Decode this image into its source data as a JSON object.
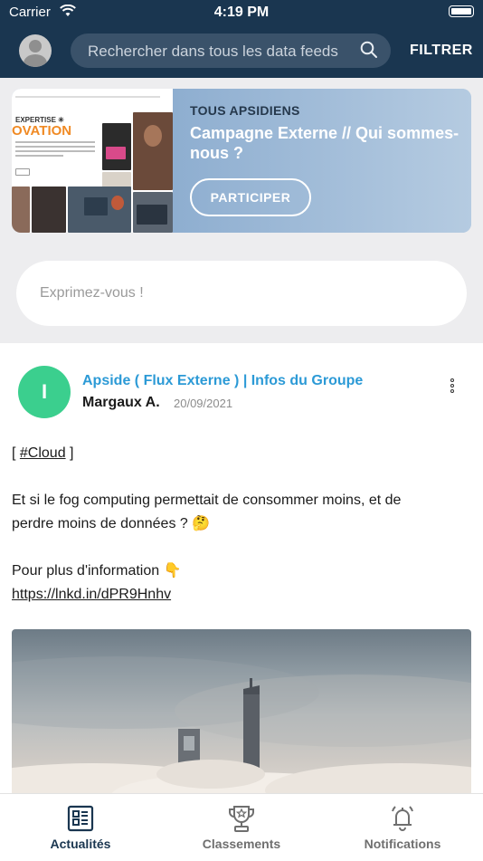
{
  "status_bar": {
    "carrier": "Carrier",
    "time": "4:19 PM"
  },
  "header": {
    "search_placeholder": "Rechercher dans tous les data feeds",
    "filter_label": "FILTRER"
  },
  "banner": {
    "tag": "TOUS APSIDIENS",
    "title": "Campagne Externe // Qui sommes-nous ?",
    "button_label": "PARTICIPER",
    "thumbnail": {
      "overline": "EXPERTISE ✳",
      "headline": "OVATION"
    }
  },
  "composer": {
    "placeholder": "Exprimez-vous !"
  },
  "post": {
    "avatar_initial": "I",
    "group": "Apside ( Flux Externe ) | Infos du Groupe",
    "author": "Margaux A.",
    "date": "20/09/2021",
    "hashtag_prefix": "[ ",
    "hashtag": "#Cloud",
    "hashtag_suffix": " ]",
    "line1": "Et si le fog computing permettait de consommer moins, et de",
    "line2": "perdre moins de données ? 🤔",
    "line3": "Pour plus d'information 👇",
    "link": "https://lnkd.in/dPR9Hnhv"
  },
  "tabs": [
    {
      "label": "Actualités",
      "icon": "news-icon",
      "active": true
    },
    {
      "label": "Classements",
      "icon": "trophy-icon",
      "active": false
    },
    {
      "label": "Notifications",
      "icon": "bell-icon",
      "active": false
    }
  ],
  "colors": {
    "header_bg": "#1a3650",
    "accent": "#2c9ad6",
    "avatar_green": "#3bcf8e",
    "tab_active": "#1a3650",
    "tab_inactive": "#6f6f6f"
  }
}
